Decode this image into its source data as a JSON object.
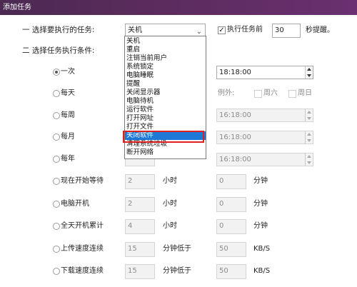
{
  "window": {
    "title": "添加任务"
  },
  "section1": {
    "label": "一 选择要执行的任务:",
    "task_selected": "关机",
    "exec_before_label": "执行任务前",
    "exec_before_checked": true,
    "seconds_value": "30",
    "seconds_suffix": "秒提醒。"
  },
  "section2": {
    "label": "二 选择任务执行条件:"
  },
  "dropdown": {
    "items": [
      "关机",
      "重启",
      "注销当前用户",
      "系统锁定",
      "电脑睡眠",
      "提醒",
      "关闭显示器",
      "电脑待机",
      "运行软件",
      "打开网址",
      "打开文件",
      "关闭软件",
      "清理系统垃圾",
      "断开网络"
    ],
    "selected": "关闭软件"
  },
  "conditions": {
    "once": "一次",
    "daily": "每天",
    "weekly": "每周",
    "monthly": "每月",
    "yearly": "每年",
    "wait_from_now": "现在开始等待",
    "pc_power_on": "电脑开机",
    "uptime_total": "全天开机累计",
    "upload_speed": "上传速度连续",
    "download_speed": "下载速度连续"
  },
  "times": {
    "once_time": "18:18:00",
    "weekly_time": "16:18:00",
    "monthly_time": "16:18:00",
    "yearly_time": "16:18:00"
  },
  "exceptions": {
    "label": "例外:",
    "saturday": "周六",
    "sunday": "周日"
  },
  "waits": {
    "wait_hours": "2",
    "wait_minutes": "0",
    "poweron_hours": "2",
    "poweron_minutes": "0",
    "uptime_hours": "4",
    "uptime_minutes": "0",
    "hour_unit": "小时",
    "minute_unit": "分钟"
  },
  "speed": {
    "upload_minutes": "15",
    "upload_kbs": "50",
    "download_minutes": "15",
    "download_kbs": "50",
    "below_label": "分钟低于",
    "unit": "KB/S"
  }
}
